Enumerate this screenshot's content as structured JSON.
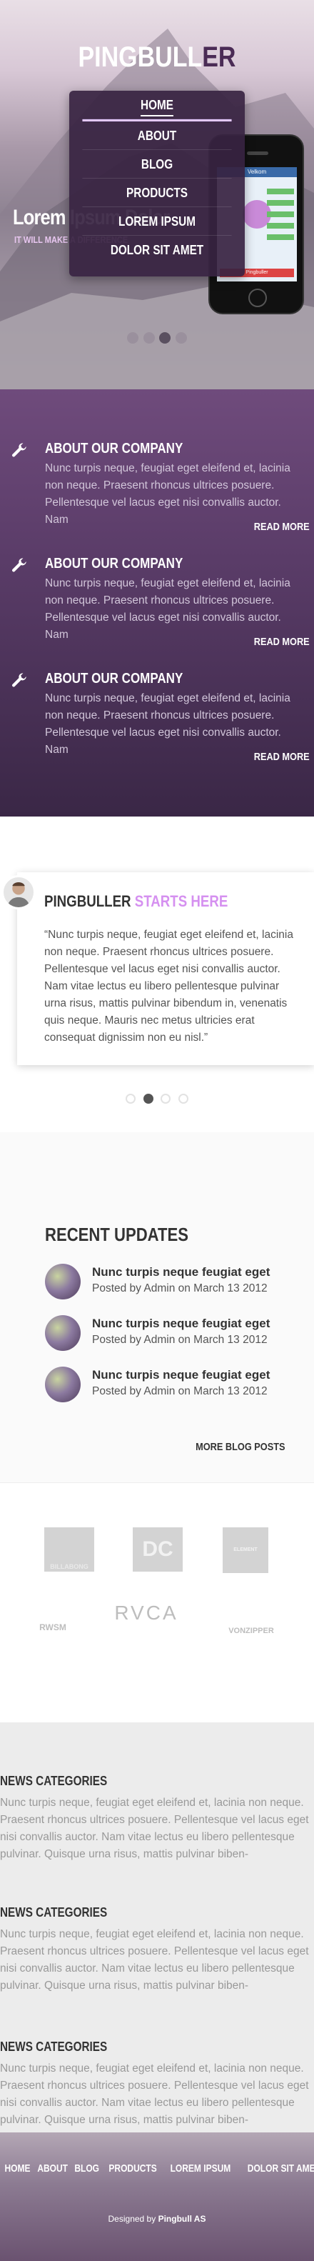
{
  "brand": {
    "name_main": "PINGBULL",
    "name_accent": "ER"
  },
  "hero": {
    "slide_title": "Lorem Ipsum Dolor",
    "slide_subtitle": "IT WILL MAKE A DIFFERENCE",
    "phone_app": {
      "title": "Velkom",
      "button": "Pingbuller"
    }
  },
  "nav": {
    "items": [
      "HOME",
      "ABOUT",
      "BLOG",
      "PRODUCTS",
      "LOREM IPSUM",
      "DOLOR SIT AMET"
    ]
  },
  "features": [
    {
      "title": "ABOUT OUR COMPANY",
      "text": "Nunc turpis neque, feugiat eget eleifend et, lacinia non neque. Praesent rhoncus ultrices posuere. Pellentesque vel lacus eget nisi convallis auctor. Nam",
      "link": "READ MORE"
    },
    {
      "title": "ABOUT OUR COMPANY",
      "text": "Nunc turpis neque, feugiat eget eleifend et, lacinia non neque. Praesent rhoncus ultrices posuere. Pellentesque vel lacus eget nisi convallis auctor. Nam",
      "link": "READ MORE"
    },
    {
      "title": "ABOUT OUR COMPANY",
      "text": "Nunc turpis neque, feugiat eget eleifend et, lacinia non neque. Praesent rhoncus ultrices posuere. Pellentesque vel lacus eget nisi convallis auctor. Nam",
      "link": "READ MORE"
    }
  ],
  "testimonial": {
    "title_main": "PINGBULLER",
    "title_accent": "STARTS HERE",
    "quote": "“Nunc turpis neque, feugiat eget eleifend et, lacinia non neque. Praesent rhoncus ultrices posuere. Pellentesque vel lacus eget nisi convallis auctor. Nam vitae lectus eu libero pellentesque pulvinar urna risus, mattis pulvinar bibendum in, venenatis quis neque. Mauris nec metus ultricies erat consequat dignissim non eu nisl.”"
  },
  "updates": {
    "heading": "RECENT UPDATES",
    "items": [
      {
        "title": "Nunc turpis neque feugiat eget",
        "meta": "Posted by Admin on March 13 2012"
      },
      {
        "title": "Nunc turpis neque feugiat eget",
        "meta": "Posted by Admin on March 13 2012"
      },
      {
        "title": "Nunc turpis neque feugiat eget",
        "meta": "Posted by Admin on March 13 2012"
      }
    ],
    "more_link": "MORE BLOG POSTS"
  },
  "logos": [
    "BILLABONG",
    "DC",
    "ELEMENT",
    "RWSM",
    "RVCA",
    "VONZIPPER"
  ],
  "news": [
    {
      "title": "NEWS CATEGORIES",
      "text": "Nunc turpis neque, feugiat eget eleifend et, lacinia non neque. Praesent rhoncus ultrices posuere. Pellentesque vel lacus eget nisi convallis auctor. Nam vitae lectus eu libero pellentesque pulvinar. Quisque urna risus, mattis pulvinar biben-"
    },
    {
      "title": "NEWS CATEGORIES",
      "text": "Nunc turpis neque, feugiat eget eleifend et, lacinia non neque. Praesent rhoncus ultrices posuere. Pellentesque vel lacus eget nisi convallis auctor. Nam vitae lectus eu libero pellentesque pulvinar. Quisque urna risus, mattis pulvinar biben-"
    },
    {
      "title": "NEWS CATEGORIES",
      "text": "Nunc turpis neque, feugiat eget eleifend et, lacinia non neque. Praesent rhoncus ultrices posuere. Pellentesque vel lacus eget nisi convallis auctor. Nam vitae lectus eu libero pellentesque pulvinar. Quisque urna risus, mattis pulvinar biben-"
    }
  ],
  "footer": {
    "nav": [
      "HOME",
      "ABOUT",
      "BLOG",
      "PRODUCTS",
      "LOREM IPSUM",
      "DOLOR SIT AMET"
    ],
    "credit_prefix": "Designed by",
    "credit_name": "Pingbull AS"
  },
  "colors": {
    "accent_purple": "#6f4b7c",
    "accent_pink": "#d590f0",
    "dark_purple": "#3a2746"
  }
}
